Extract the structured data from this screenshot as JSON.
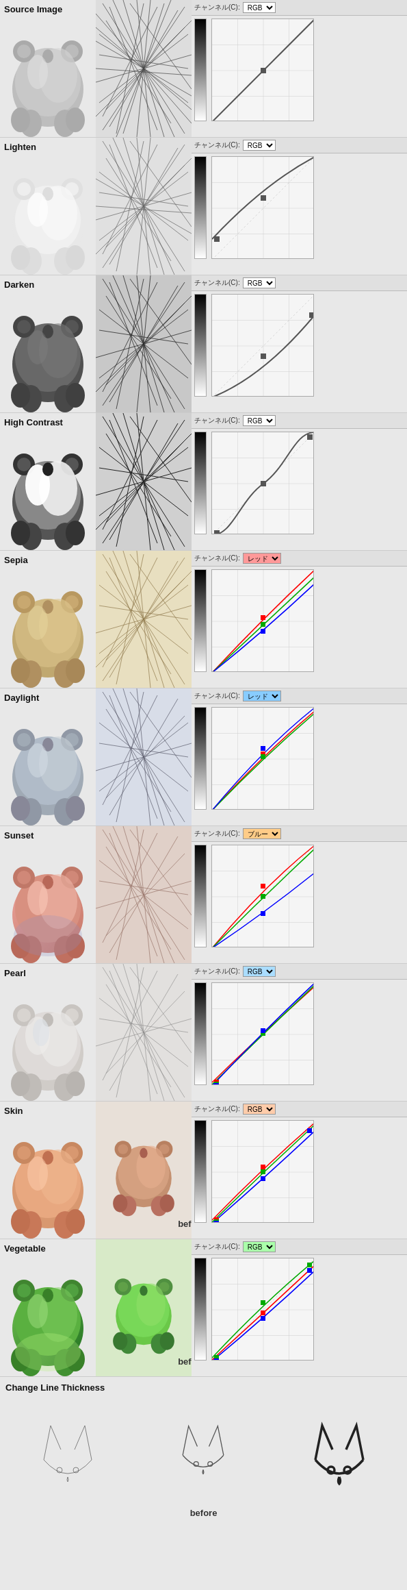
{
  "sections": [
    {
      "id": "source",
      "label": "Source  Image",
      "tint": "source",
      "animalColor": "#b0b0b0",
      "sketchBg": "#e5e5e5",
      "curveChannel": "RGB",
      "curveDropdownColor": "#fff",
      "curveType": "diagonal",
      "showBefore": false,
      "hasBefore3d": false
    },
    {
      "id": "lighten",
      "label": "Lighten",
      "tint": "lighten",
      "animalColor": "#d8d8d8",
      "sketchBg": "#e8e8e8",
      "curveChannel": "RGB",
      "curveDropdownColor": "#fff",
      "curveType": "lighten",
      "showBefore": false,
      "hasBefore3d": false
    },
    {
      "id": "darken",
      "label": "Darken",
      "tint": "darken",
      "animalColor": "#606060",
      "sketchBg": "#ddd",
      "curveChannel": "RGB",
      "curveDropdownColor": "#fff",
      "curveType": "darken",
      "showBefore": false,
      "hasBefore3d": false
    },
    {
      "id": "high_contrast",
      "label": "High  Contrast",
      "tint": "high-contrast",
      "animalColor": "#888",
      "sketchBg": "#e0e0e0",
      "curveChannel": "RGB",
      "curveDropdownColor": "#fff",
      "curveType": "s-curve",
      "showBefore": false,
      "hasBefore3d": false
    },
    {
      "id": "sepia",
      "label": "Sepia",
      "tint": "sepia",
      "animalColor": "#b8a87a",
      "sketchBg": "#ebe0c8",
      "curveChannel": "レッド",
      "curveDropdownColor": "#ff9999",
      "curveType": "multi",
      "showBefore": false,
      "hasBefore3d": false
    },
    {
      "id": "daylight",
      "label": "Daylight",
      "tint": "daylight",
      "animalColor": "#aabbc0",
      "sketchBg": "#d8dde0",
      "curveChannel": "レッド",
      "curveDropdownColor": "#88ccff",
      "curveType": "multi-daylight",
      "showBefore": false,
      "hasBefore3d": false
    },
    {
      "id": "sunset",
      "label": "Sunset",
      "tint": "sunset",
      "animalColor": "#c89080",
      "sketchBg": "#e8d8d0",
      "curveChannel": "ブルー",
      "curveDropdownColor": "#ffcc88",
      "curveType": "multi-sunset",
      "showBefore": false,
      "hasBefore3d": false
    },
    {
      "id": "pearl",
      "label": "Pearl",
      "tint": "pearl",
      "animalColor": "#c8c0b8",
      "sketchBg": "#e5e3e0",
      "curveChannel": "RGB",
      "curveDropdownColor": "#aaddff",
      "curveType": "multi-pearl",
      "showBefore": false,
      "hasBefore3d": false
    },
    {
      "id": "skin",
      "label": "Skin",
      "tint": "skin",
      "animalColor": "#d09878",
      "sketchBg": "#e8ddd0",
      "curveChannel": "RGB",
      "curveDropdownColor": "#ffccaa",
      "curveType": "multi-skin",
      "showBefore": true,
      "hasBefore3d": true
    },
    {
      "id": "vegetable",
      "label": "Vegetable",
      "tint": "vegetable",
      "animalColor": "#50a840",
      "sketchBg": "#d8ead0",
      "curveChannel": "RGB",
      "curveDropdownColor": "#aaffaa",
      "curveType": "multi-veg",
      "showBefore": true,
      "hasBefore3d": true
    }
  ],
  "change_line_thickness": {
    "title": "Change Line Thickness",
    "before_label": "before"
  },
  "curve_label": "チャンネル(C):",
  "before_label": "before"
}
